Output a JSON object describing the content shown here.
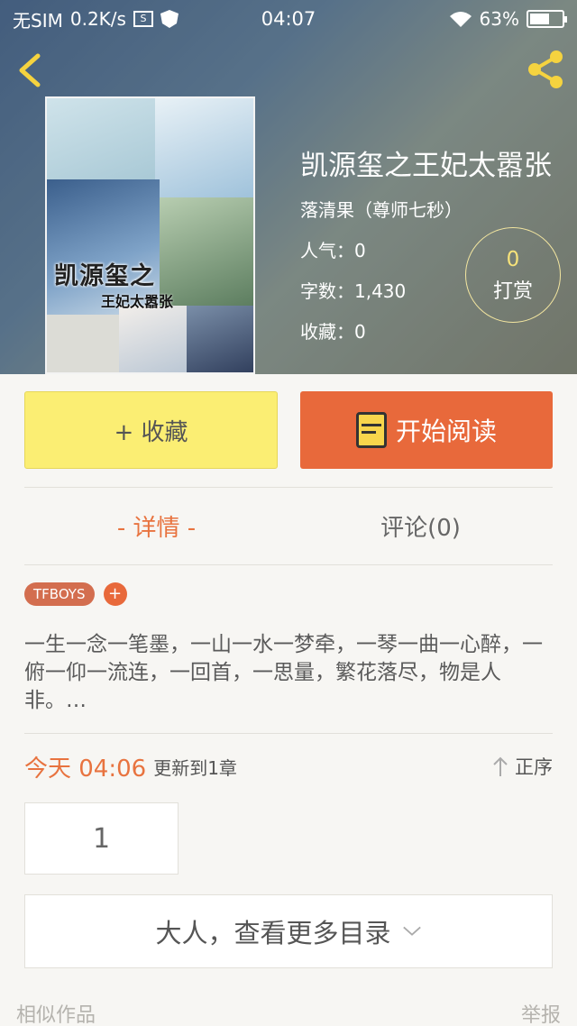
{
  "status_bar": {
    "carrier": "无SIM",
    "speed": "0.2K/s",
    "time": "04:07",
    "battery_text": "63%",
    "battery_level": 0.63
  },
  "book": {
    "cover_title": "凯源玺之",
    "cover_subtitle": "王妃太嚣张",
    "title": "凯源玺之王妃太嚣张",
    "author": "落清果（尊师七秒）",
    "popularity": "人气：0",
    "word_count": "字数：1,430",
    "favorites": "收藏：0"
  },
  "reward": {
    "count": "0",
    "label": "打赏"
  },
  "actions": {
    "collect_label": "+ 收藏",
    "read_label": "开始阅读"
  },
  "tabs": [
    {
      "label": "- 详情 -"
    },
    {
      "label": "评论(0)"
    }
  ],
  "tags": [
    "TFBOYS"
  ],
  "tag_add": "+",
  "description": "一生一念一笔墨，一山一水一梦牵，一琴一曲一心醉，一俯一仰一流连，一回首，一思量，繁花落尽，物是人非。…",
  "update": {
    "time": "今天 04:06",
    "text": "更新到1章",
    "sort_label": "正序"
  },
  "chapters": [
    "1"
  ],
  "more_label": "大人，查看更多目录",
  "footer": {
    "left": "相似作品",
    "right": "举报"
  },
  "colors": {
    "accent": "#e8693b",
    "collect": "#fbee73",
    "tag": "#d36e4f"
  }
}
